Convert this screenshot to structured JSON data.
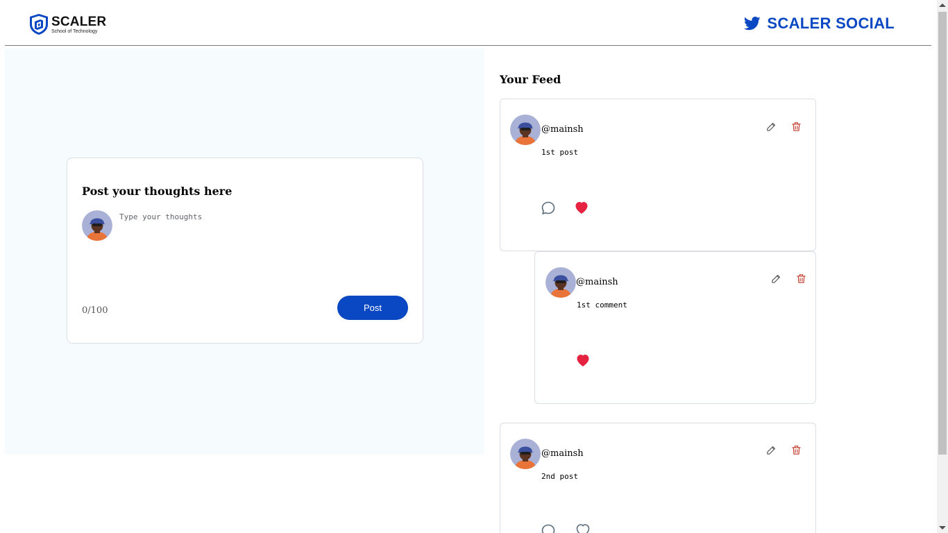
{
  "header": {
    "logo_title": "SCALER",
    "logo_subtitle": "School of Technology",
    "brand_name": "SCALER SOCIAL"
  },
  "composer": {
    "title": "Post your thoughts here",
    "placeholder": "Type your thoughts",
    "char_count": "0/100",
    "post_label": "Post"
  },
  "feed": {
    "title": "Your Feed",
    "posts": [
      {
        "handle": "@mainsh",
        "content": "1st post",
        "liked": true,
        "has_comment_icon": true
      },
      {
        "handle": "@mainsh",
        "content": "1st comment",
        "liked": true,
        "has_comment_icon": false,
        "is_comment": true
      },
      {
        "handle": "@mainsh",
        "content": "2nd post",
        "liked": false,
        "has_comment_icon": true
      }
    ]
  },
  "colors": {
    "brand_blue": "#0a47c2",
    "like_red": "#e5223f",
    "delete_red": "#c0392b",
    "panel_bg": "#f6fbfd"
  },
  "icons": {
    "edit": "pencil-icon",
    "delete": "trash-icon",
    "comment": "speech-bubble-icon",
    "like": "heart-icon",
    "brand": "bird-icon"
  }
}
